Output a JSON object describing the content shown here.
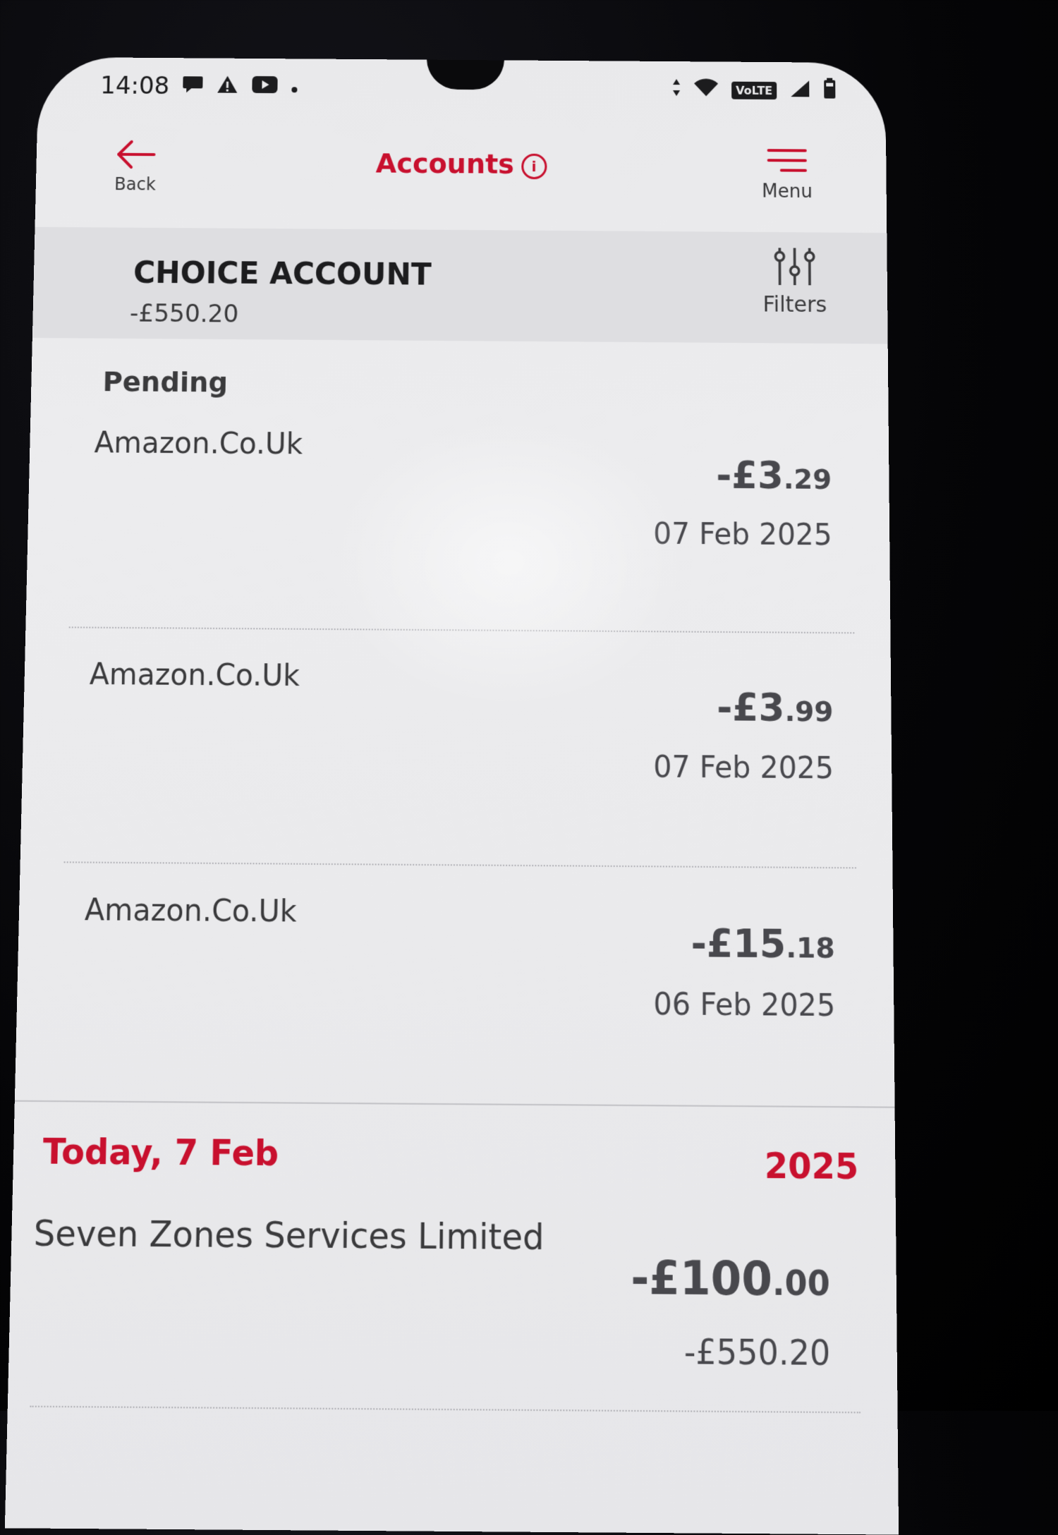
{
  "status_bar": {
    "time": "14:08",
    "network_label": "VoLTE"
  },
  "header": {
    "back_label": "Back",
    "title": "Accounts",
    "info_glyph": "i",
    "menu_label": "Menu"
  },
  "account": {
    "name": "CHOICE ACCOUNT",
    "balance": "-£550.20",
    "filters_label": "Filters"
  },
  "pending": {
    "title": "Pending",
    "transactions": [
      {
        "merchant": "Amazon.Co.Uk",
        "amount_main": "-£3",
        "amount_pence": ".29",
        "date": "07 Feb 2025"
      },
      {
        "merchant": "Amazon.Co.Uk",
        "amount_main": "-£3",
        "amount_pence": ".99",
        "date": "07 Feb 2025"
      },
      {
        "merchant": "Amazon.Co.Uk",
        "amount_main": "-£15",
        "amount_pence": ".18",
        "date": "06 Feb 2025"
      }
    ]
  },
  "today": {
    "label": "Today, 7 Feb",
    "year": "2025",
    "transactions": [
      {
        "merchant": "Seven Zones Services Limited",
        "amount_main": "-£100",
        "amount_pence": ".00",
        "running_balance": "-£550.20"
      }
    ]
  },
  "colors": {
    "brand_red": "#c8102e",
    "text_dark": "#1c1c1e",
    "text_grey": "#48484d"
  },
  "icons": [
    "chat-icon",
    "warning-icon",
    "youtube-icon",
    "wifi-icon",
    "signal-icon",
    "battery-icon",
    "back-arrow-icon",
    "info-icon",
    "menu-icon",
    "filters-icon"
  ]
}
